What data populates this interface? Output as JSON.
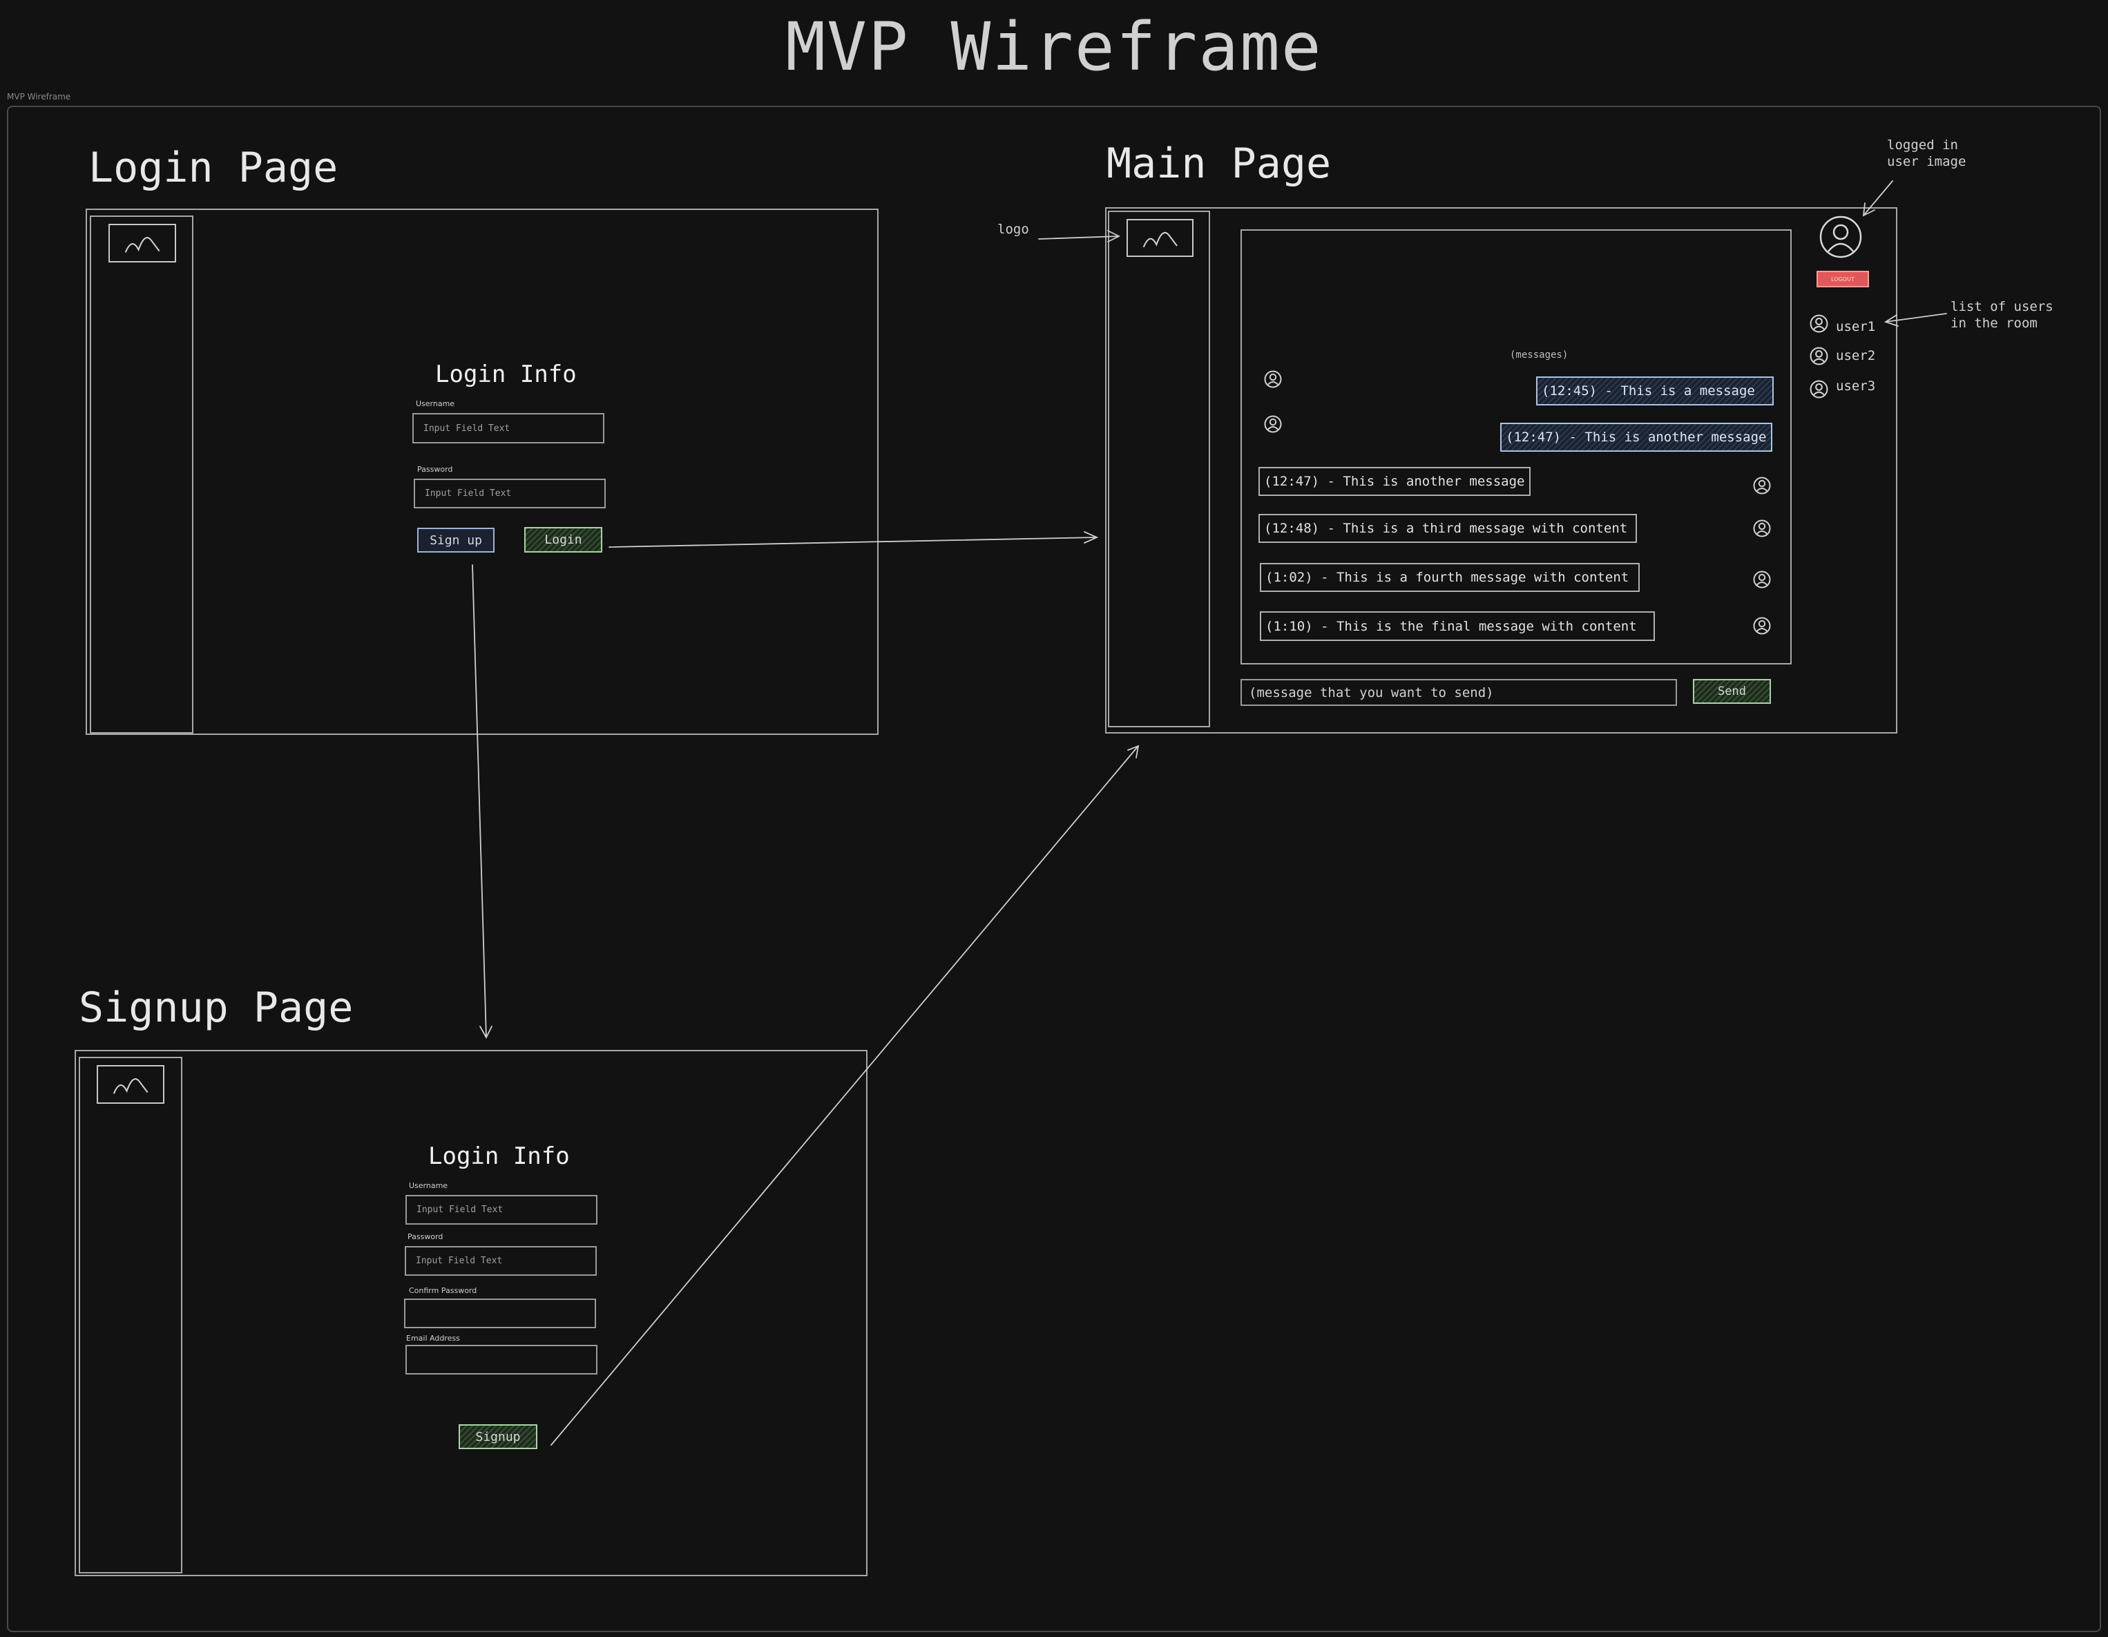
{
  "title": "MVP Wireframe",
  "frame_label": "MVP Wireframe",
  "login_page": {
    "title": "Login Page",
    "heading": "Login Info",
    "username_label": "Username",
    "username_placeholder": "Input Field Text",
    "password_label": "Password",
    "password_placeholder": "Input Field Text",
    "signup_button": "Sign up",
    "login_button": "Login"
  },
  "main_page": {
    "title": "Main Page",
    "messages_label": "(messages)",
    "messages": [
      {
        "text": "(12:45) - This is a message",
        "own": true
      },
      {
        "text": "(12:47) - This is another message",
        "own": true
      },
      {
        "text": "(12:47) - This is another message",
        "own": false
      },
      {
        "text": "(12:48) - This is a third message with content",
        "own": false
      },
      {
        "text": "(1:02) - This is a fourth message with content",
        "own": false
      },
      {
        "text": "(1:10) - This is the final message with content",
        "own": false
      }
    ],
    "compose_placeholder": "(message that you want to send)",
    "send_button": "Send",
    "logout_button": "LOGOUT",
    "users": [
      "user1",
      "user2",
      "user3"
    ]
  },
  "signup_page": {
    "title": "Signup Page",
    "heading": "Login Info",
    "username_label": "Username",
    "username_placeholder": "Input Field Text",
    "password_label": "Password",
    "password_placeholder": "Input Field Text",
    "confirm_label": "Confirm Password",
    "email_label": "Email Address",
    "signup_button": "Signup"
  },
  "annotations": {
    "logo": "logo",
    "user_image": [
      "logged in",
      "user image"
    ],
    "user_list": [
      "list of users",
      "in the room"
    ]
  },
  "colors": {
    "background": "#121212",
    "logout": "#e25858",
    "primary_button": "#a9d4a4",
    "secondary_button": "#9fb4d4"
  },
  "icons": [
    "image-placeholder-icon",
    "user-avatar-icon",
    "arrow-icon"
  ]
}
